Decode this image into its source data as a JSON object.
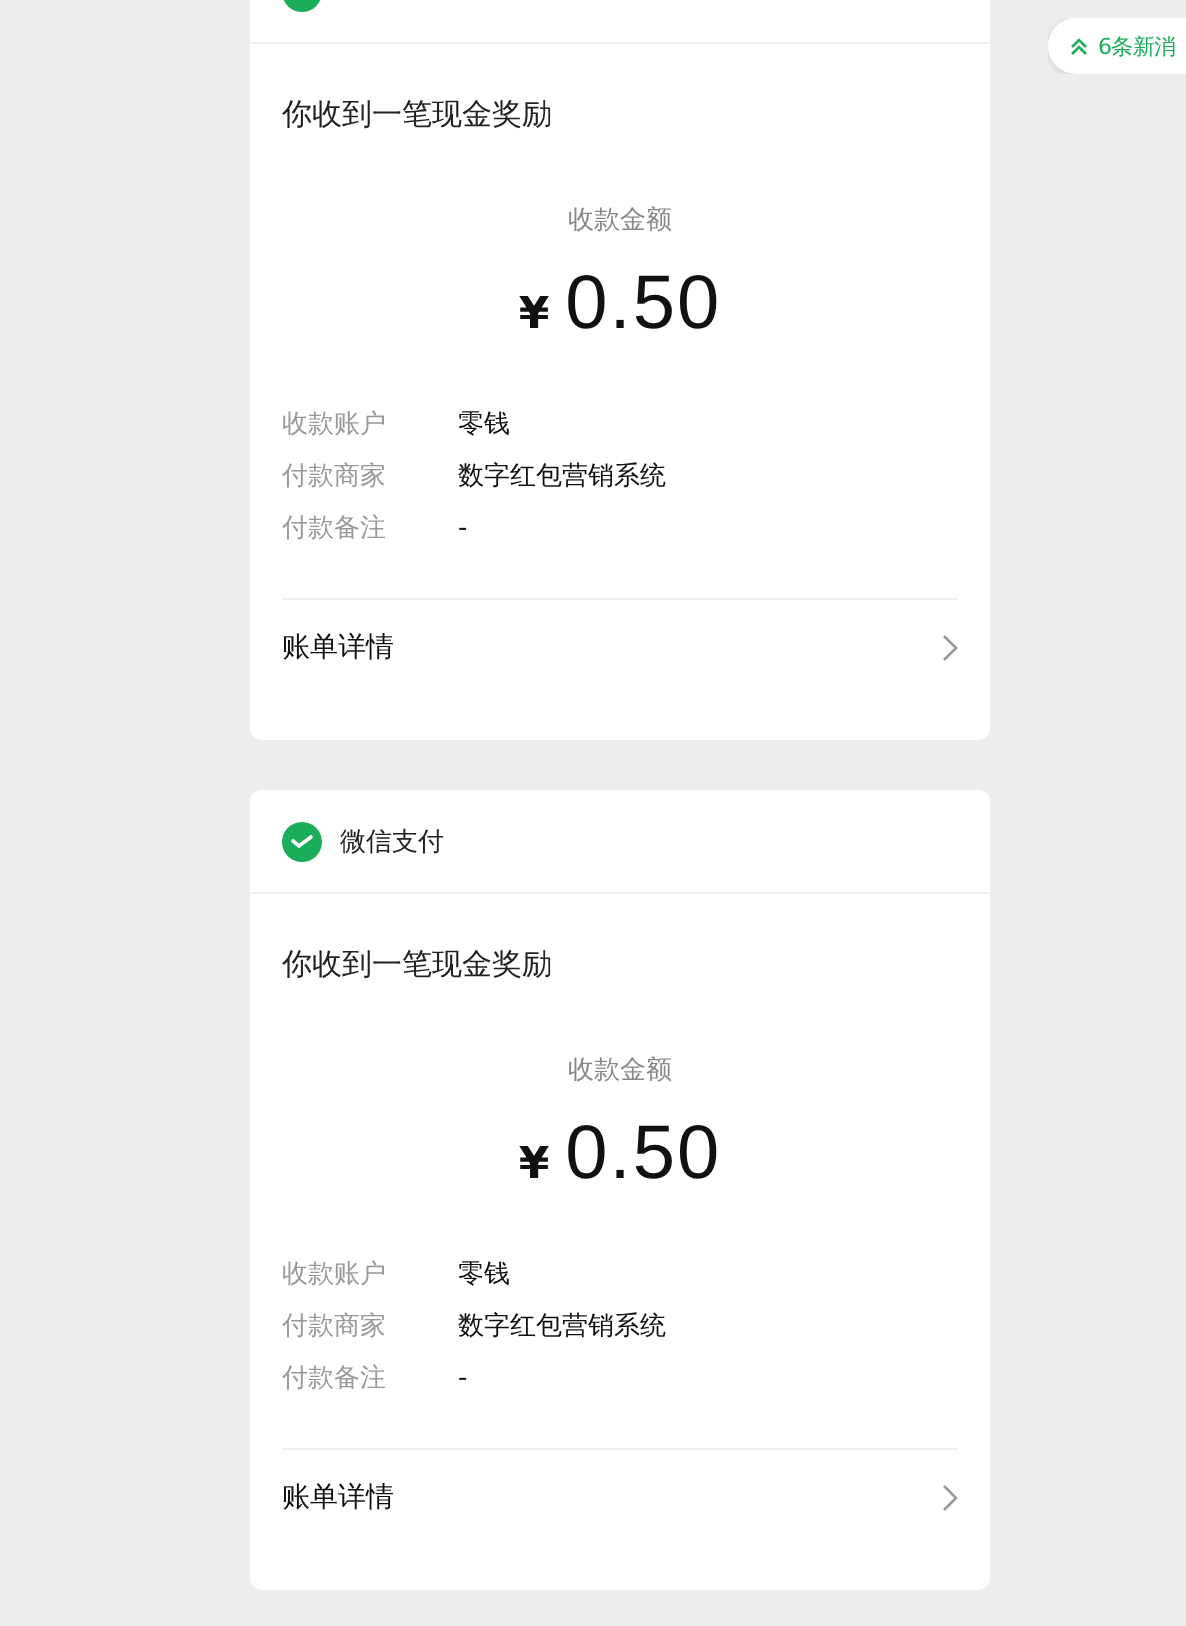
{
  "notices": [
    {
      "title": "你收到一笔现金奖励",
      "amount_label": "收款金额",
      "currency": "¥",
      "amount": "0.50",
      "rows": [
        {
          "label": "收款账户",
          "value": "零钱"
        },
        {
          "label": "付款商家",
          "value": "数字红包营销系统"
        },
        {
          "label": "付款备注",
          "value": "-"
        }
      ],
      "link": "账单详情"
    },
    {
      "source": "微信支付",
      "title": "你收到一笔现金奖励",
      "amount_label": "收款金额",
      "currency": "¥",
      "amount": "0.50",
      "rows": [
        {
          "label": "收款账户",
          "value": "零钱"
        },
        {
          "label": "付款商家",
          "value": "数字红包营销系统"
        },
        {
          "label": "付款备注",
          "value": "-"
        }
      ],
      "link": "账单详情"
    }
  ],
  "new_messages": {
    "label": "6条新消"
  }
}
